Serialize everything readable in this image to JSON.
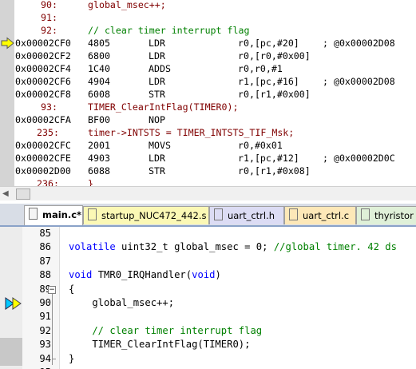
{
  "disassembly": {
    "lines": [
      {
        "kind": "src",
        "num": "90:",
        "code": "global_msec++;"
      },
      {
        "kind": "src",
        "num": "91:",
        "code": ""
      },
      {
        "kind": "src",
        "num": "92:",
        "code": "// clear timer interrupt flag",
        "comment": true
      },
      {
        "kind": "asm",
        "addr": "0x00002CF0",
        "hex": "4805",
        "mn": "LDR",
        "op": "r0,[pc,#20]",
        "ac": "; @0x00002D08",
        "current": true
      },
      {
        "kind": "asm",
        "addr": "0x00002CF2",
        "hex": "6800",
        "mn": "LDR",
        "op": "r0,[r0,#0x00]",
        "ac": ""
      },
      {
        "kind": "asm",
        "addr": "0x00002CF4",
        "hex": "1C40",
        "mn": "ADDS",
        "op": "r0,r0,#1",
        "ac": ""
      },
      {
        "kind": "asm",
        "addr": "0x00002CF6",
        "hex": "4904",
        "mn": "LDR",
        "op": "r1,[pc,#16]",
        "ac": "; @0x00002D08"
      },
      {
        "kind": "asm",
        "addr": "0x00002CF8",
        "hex": "6008",
        "mn": "STR",
        "op": "r0,[r1,#0x00]",
        "ac": ""
      },
      {
        "kind": "src",
        "num": "93:",
        "code": "TIMER_ClearIntFlag(TIMER0);"
      },
      {
        "kind": "asm",
        "addr": "0x00002CFA",
        "hex": "BF00",
        "mn": "NOP",
        "op": "",
        "ac": ""
      },
      {
        "kind": "src",
        "num": "235:",
        "code": "timer->INTSTS = TIMER_INTSTS_TIF_Msk;"
      },
      {
        "kind": "asm",
        "addr": "0x00002CFC",
        "hex": "2001",
        "mn": "MOVS",
        "op": "r0,#0x01",
        "ac": ""
      },
      {
        "kind": "asm",
        "addr": "0x00002CFE",
        "hex": "4903",
        "mn": "LDR",
        "op": "r1,[pc,#12]",
        "ac": "; @0x00002D0C"
      },
      {
        "kind": "asm",
        "addr": "0x00002D00",
        "hex": "6088",
        "mn": "STR",
        "op": "r0,[r1,#0x08]",
        "ac": ""
      },
      {
        "kind": "src",
        "num": "236:",
        "code": "}"
      }
    ]
  },
  "tabs": [
    {
      "label": "main.c*",
      "active": true,
      "color": "#ffffff"
    },
    {
      "label": "startup_NUC472_442.s",
      "active": false,
      "color": "#fbf8b5"
    },
    {
      "label": "uart_ctrl.h",
      "active": false,
      "color": "#dcdcf4"
    },
    {
      "label": "uart_ctrl.c",
      "active": false,
      "color": "#fde8b8"
    },
    {
      "label": "thyristor",
      "active": false,
      "color": "#dff0d8"
    }
  ],
  "editor": {
    "lines": [
      {
        "num": "85",
        "parts": []
      },
      {
        "num": "86",
        "parts": [
          {
            "t": "kw",
            "v": "volatile"
          },
          {
            "t": "p",
            "v": " uint32_t global_msec = 0; "
          },
          {
            "t": "c",
            "v": "//global timer. 42 ds"
          }
        ]
      },
      {
        "num": "87",
        "parts": []
      },
      {
        "num": "88",
        "parts": [
          {
            "t": "kw",
            "v": "void"
          },
          {
            "t": "p",
            "v": " TMR0_IRQHandler("
          },
          {
            "t": "kw",
            "v": "void"
          },
          {
            "t": "p",
            "v": ")"
          }
        ]
      },
      {
        "num": "89",
        "parts": [
          {
            "t": "p",
            "v": "{"
          }
        ]
      },
      {
        "num": "90",
        "parts": [
          {
            "t": "p",
            "v": "    global_msec++;"
          }
        ]
      },
      {
        "num": "91",
        "parts": []
      },
      {
        "num": "92",
        "parts": [
          {
            "t": "c",
            "v": "    // clear timer interrupt flag"
          }
        ]
      },
      {
        "num": "93",
        "parts": [
          {
            "t": "p",
            "v": "    TIMER_ClearIntFlag(TIMER0);"
          }
        ]
      },
      {
        "num": "94",
        "parts": [
          {
            "t": "p",
            "v": "}"
          }
        ]
      },
      {
        "num": "95",
        "parts": []
      }
    ]
  },
  "colors": {
    "arrow_yellow": "#ffff00",
    "arrow_cyan": "#00c8ff",
    "source_text": "#800000",
    "keyword": "#0000ff",
    "comment": "#008000"
  },
  "icons": {
    "current_instruction": "yellow-arrow-icon",
    "pc_marker": "debug-arrows-icon",
    "fold_toggle": "minus-box-icon",
    "scroll_left": "scroll-left-icon"
  }
}
